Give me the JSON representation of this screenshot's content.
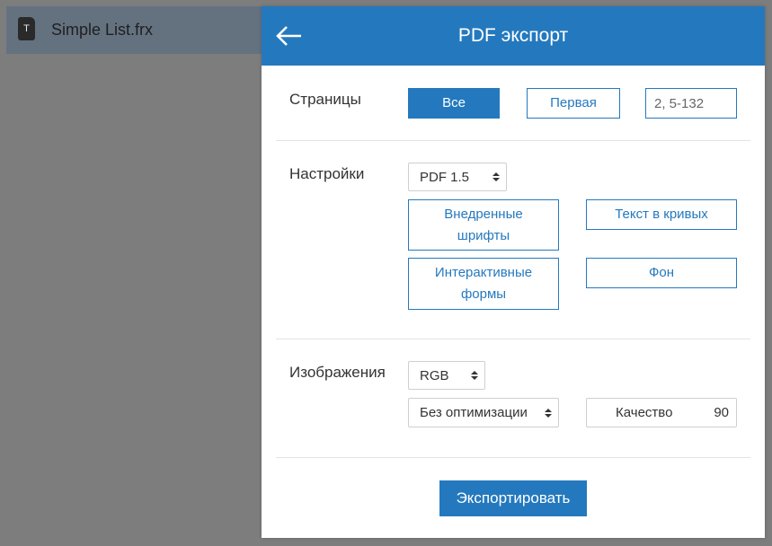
{
  "file": {
    "name": "Simple List.frx",
    "icon_letter": "T"
  },
  "dialog": {
    "title": "PDF экспорт",
    "back_icon": "arrow-left-icon",
    "pages": {
      "label": "Страницы",
      "all": "Все",
      "first": "Первая",
      "range_value": "2, 5-132"
    },
    "settings": {
      "label": "Настройки",
      "pdf_version": "PDF 1.5",
      "embedded_fonts": "Внедренные шрифты",
      "text_in_curves": "Текст в кривых",
      "interactive_forms": "Интерактивные формы",
      "background": "Фон"
    },
    "images": {
      "label": "Изображения",
      "color_space": "RGB",
      "optimization": "Без оптимизации",
      "quality_label": "Качество",
      "quality_value": "90"
    },
    "export_button": "Экспортировать"
  },
  "colors": {
    "accent": "#2479be",
    "overlay": "#7d7d7d",
    "file_bar": "#647280"
  }
}
